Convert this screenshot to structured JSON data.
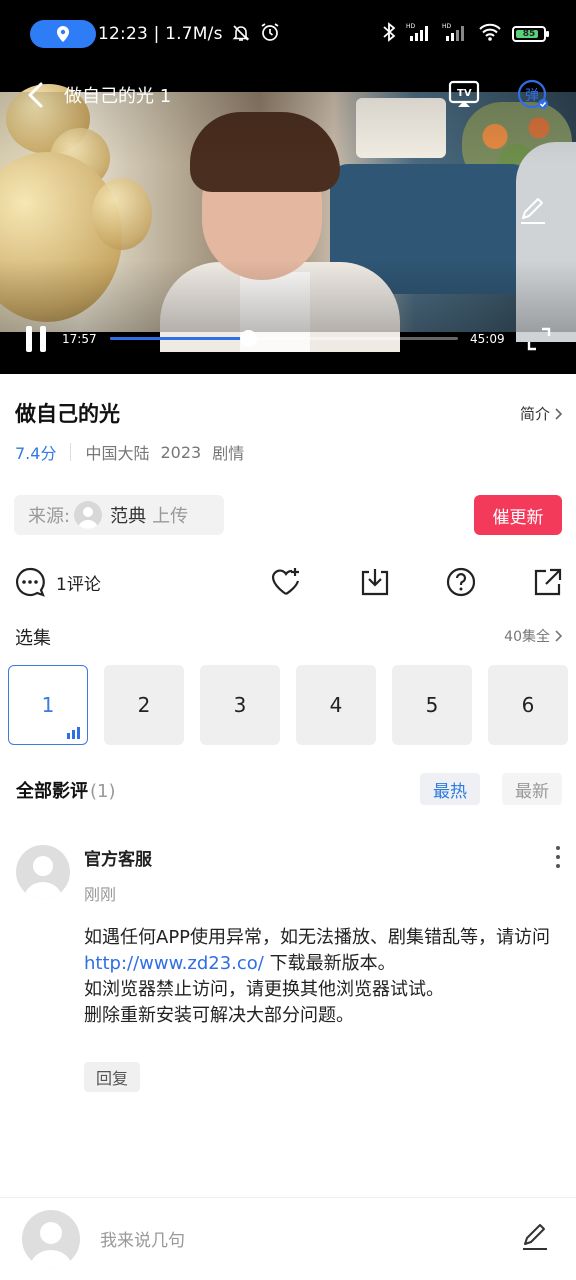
{
  "status_bar": {
    "time": "12:23",
    "speed": "1.7M/s",
    "battery": "85",
    "icons": [
      "location-icon",
      "bell-off-icon",
      "alarm-icon",
      "bluetooth-icon",
      "signal-hd-icon",
      "signal-hd-icon",
      "wifi-icon",
      "battery-icon"
    ]
  },
  "player": {
    "title": "做自己的光 1",
    "current_time": "17:57",
    "total_time": "45:09",
    "progress": 0.397,
    "accent_color": "#2f6ee5"
  },
  "show": {
    "title": "做自己的光",
    "intro_label": "简介",
    "score": "7.4分",
    "region": "中国大陆",
    "year": "2023",
    "genre": "剧情",
    "source_label": "来源:",
    "uploader": "范典",
    "upload_suffix": "上传",
    "urge_label": "催更新",
    "urge_color": "#f43a5a"
  },
  "actions": {
    "comment_count": "1评论"
  },
  "episodes": {
    "label": "选集",
    "all_label": "40集全",
    "items": [
      "1",
      "2",
      "3",
      "4",
      "5",
      "6"
    ],
    "active_index": 0
  },
  "reviews": {
    "label": "全部影评",
    "count": "(1)",
    "sort_hot": "最热",
    "sort_new": "最新",
    "comments": [
      {
        "author": "官方客服",
        "time": "刚刚",
        "line1": "如遇任何APP使用异常，如无法播放、剧集错乱等，请访问",
        "link": "http://www.zd23.co/",
        "line2": " 下载最新版本。",
        "line3": "如浏览器禁止访问，请更换其他浏览器试试。",
        "line4": "删除重新安装可解决大部分问题。",
        "reply_label": "回复"
      }
    ]
  },
  "bottom_bar": {
    "placeholder": "我来说几句"
  }
}
